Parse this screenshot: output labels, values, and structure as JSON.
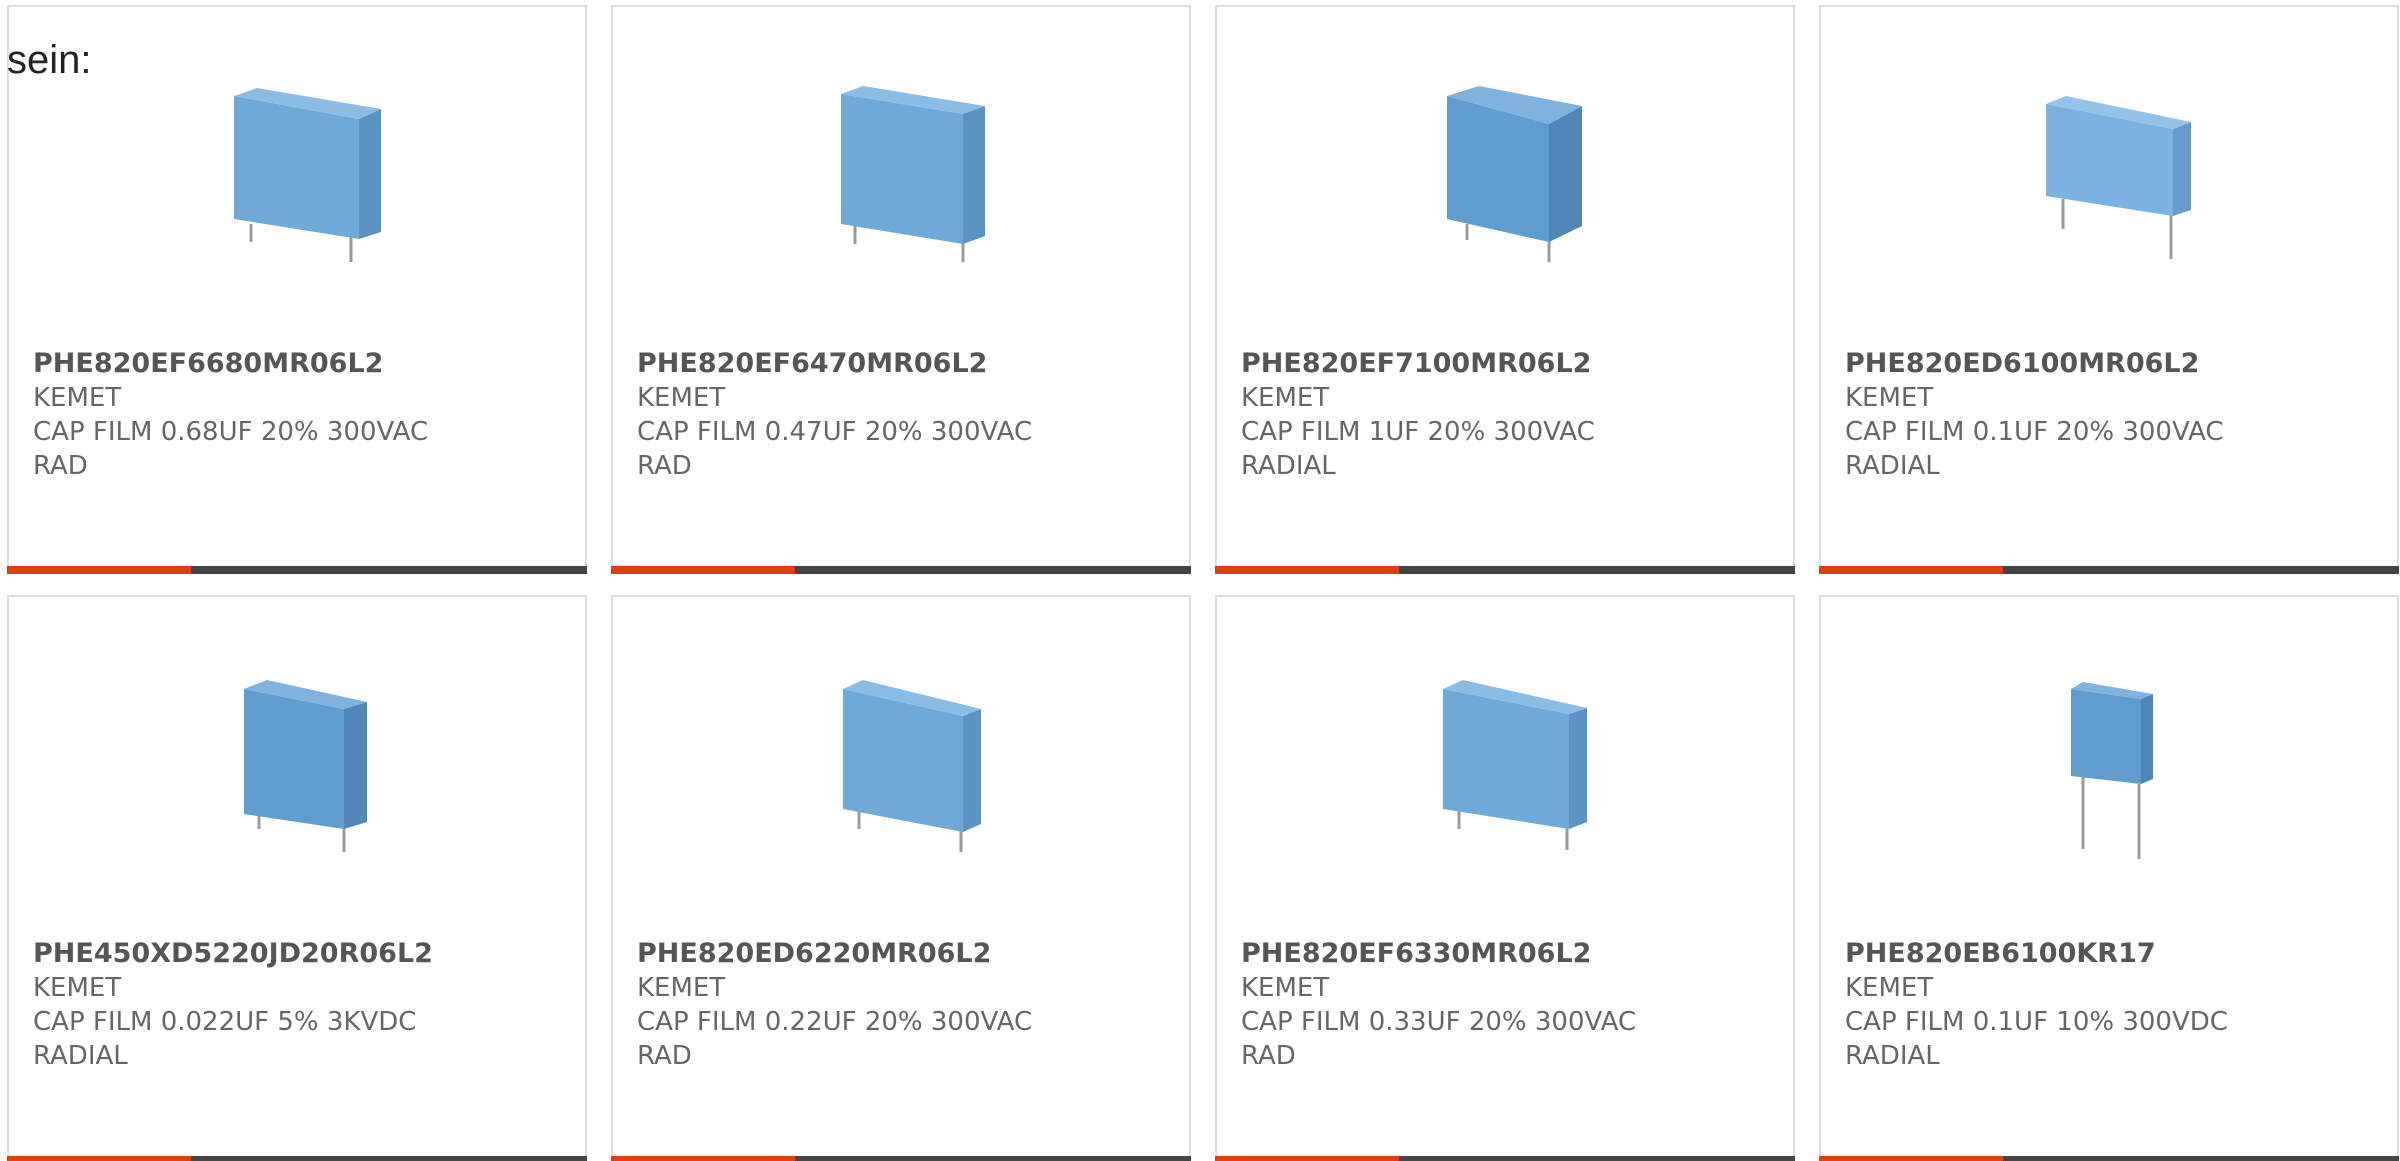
{
  "intro_text": "sein:",
  "colors": {
    "accent": "#e23d13",
    "bar": "#444444",
    "part_text": "#555555",
    "body_text": "#666666",
    "capacitor_body": "#6fa9d8",
    "capacitor_side": "#5b93c2",
    "capacitor_top": "#8bbde4"
  },
  "products": [
    {
      "part": "PHE820EF6680MR06L2",
      "manufacturer": "KEMET",
      "description": "CAP FILM 0.68UF 20% 300VAC RAD",
      "image": "capacitor-wide"
    },
    {
      "part": "PHE820EF6470MR06L2",
      "manufacturer": "KEMET",
      "description": "CAP FILM 0.47UF 20% 300VAC RAD",
      "image": "capacitor-wide"
    },
    {
      "part": "PHE820EF7100MR06L2",
      "manufacturer": "KEMET",
      "description": "CAP FILM 1UF 20% 300VAC RADIAL",
      "image": "capacitor-wide"
    },
    {
      "part": "PHE820ED6100MR06L2",
      "manufacturer": "KEMET",
      "description": "CAP FILM 0.1UF 20% 300VAC RADIAL",
      "image": "capacitor-wide"
    },
    {
      "part": "PHE450XD5220JD20R06L2",
      "manufacturer": "KEMET",
      "description": "CAP FILM 0.022UF 5% 3KVDC RADIAL",
      "image": "capacitor-wide"
    },
    {
      "part": "PHE820ED6220MR06L2",
      "manufacturer": "KEMET",
      "description": "CAP FILM 0.22UF 20% 300VAC RAD",
      "image": "capacitor-wide"
    },
    {
      "part": "PHE820EF6330MR06L2",
      "manufacturer": "KEMET",
      "description": "CAP FILM 0.33UF 20% 300VAC RAD",
      "image": "capacitor-wide"
    },
    {
      "part": "PHE820EB6100KR17",
      "manufacturer": "KEMET",
      "description": "CAP FILM 0.1UF 10% 300VDC RADIAL",
      "image": "capacitor-small-long-leads"
    }
  ]
}
